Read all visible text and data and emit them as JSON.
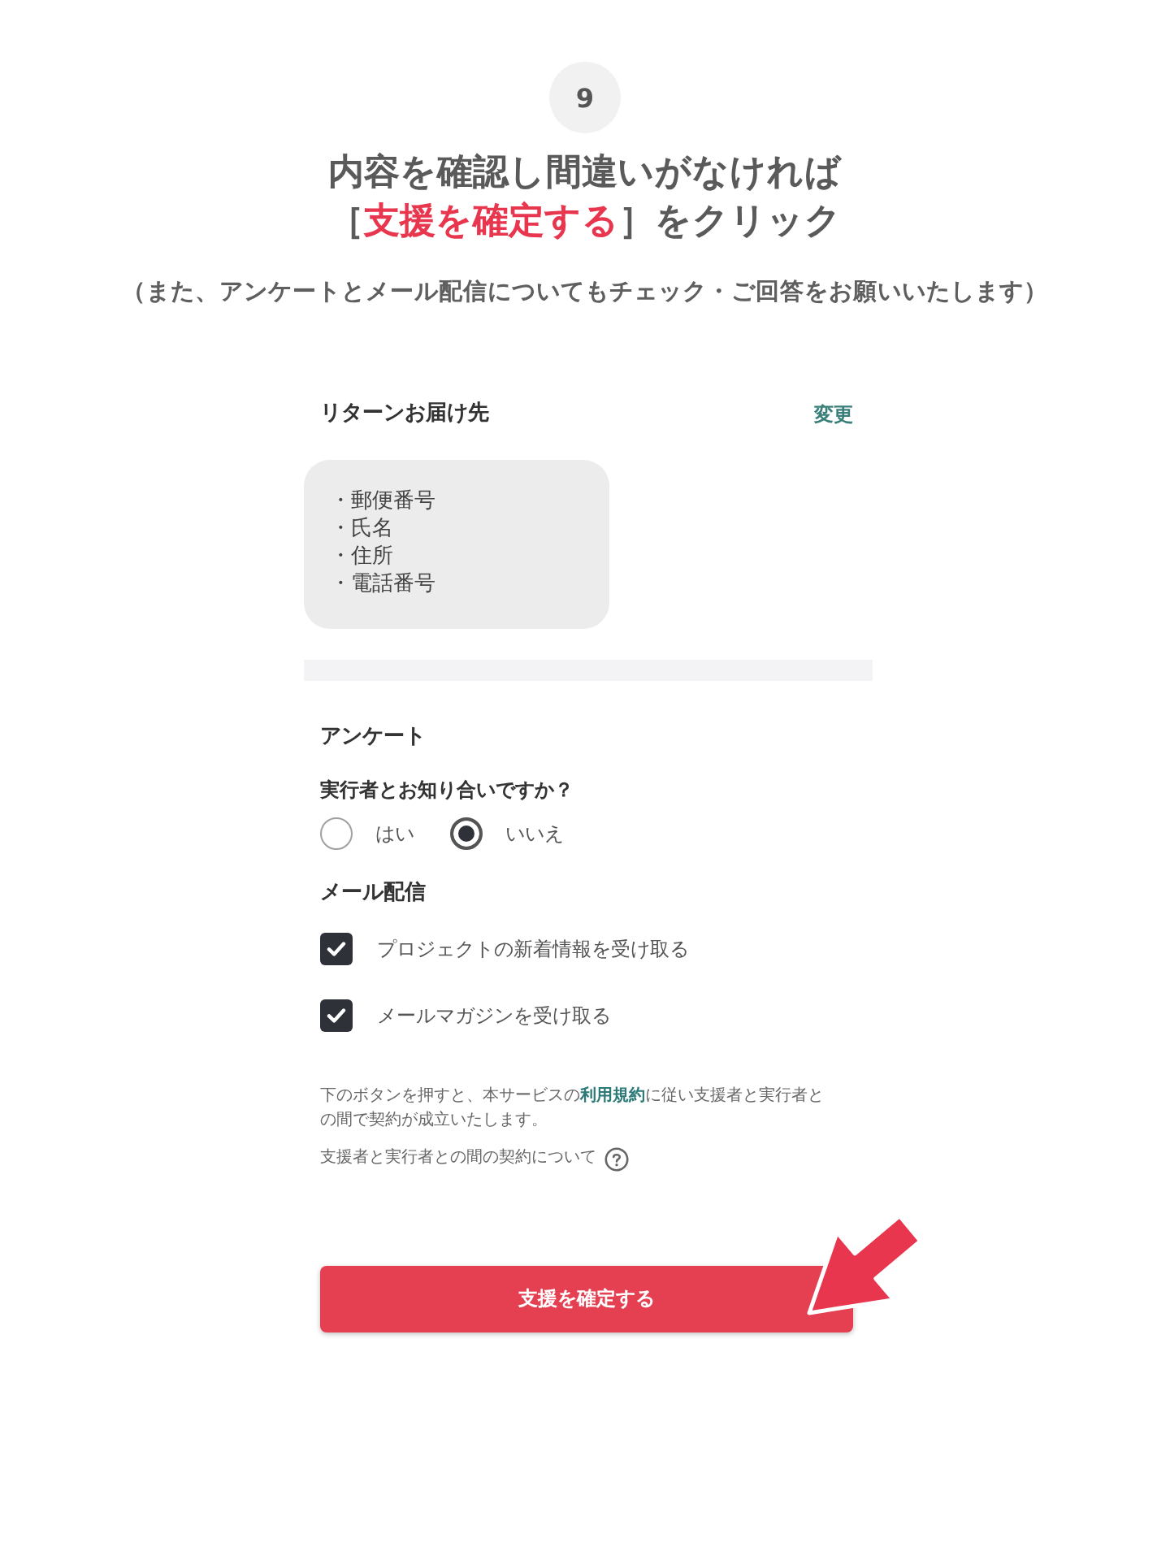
{
  "step": {
    "number": "9"
  },
  "heading": {
    "lines": [
      [
        {
          "text": "内容を確認し間違いがなければ",
          "highlight": false
        }
      ],
      [
        {
          "text": "［",
          "highlight": false
        },
        {
          "text": "支援を確定する",
          "highlight": true
        },
        {
          "text": "］をクリック",
          "highlight": false
        }
      ]
    ]
  },
  "note": "（また、アンケートとメール配信についてもチェック・ご回答をお願いいたします）",
  "screenshot": {
    "shipping": {
      "title": "リターンお届け先",
      "edit_link": "変更",
      "fields": [
        "・郵便番号",
        "・氏名",
        "・住所",
        "・電話番号"
      ]
    },
    "survey": {
      "title": "アンケート",
      "question": "実行者とお知り合いですか？",
      "options": [
        {
          "label": "はい",
          "selected": false
        },
        {
          "label": "いいえ",
          "selected": true
        }
      ]
    },
    "mail": {
      "title": "メール配信",
      "options": [
        {
          "label": "プロジェクトの新着情報を受け取る",
          "checked": true
        },
        {
          "label": "メールマガジンを受け取る",
          "checked": true
        }
      ]
    },
    "terms": {
      "before": "下のボタンを押すと、本サービスの",
      "link": "利用規約",
      "after": "に従い支援者と実行者との間で契約が成立いたします。"
    },
    "contract_info": "支援者と実行者との間の契約について",
    "confirm_button": "支援を確定する"
  }
}
